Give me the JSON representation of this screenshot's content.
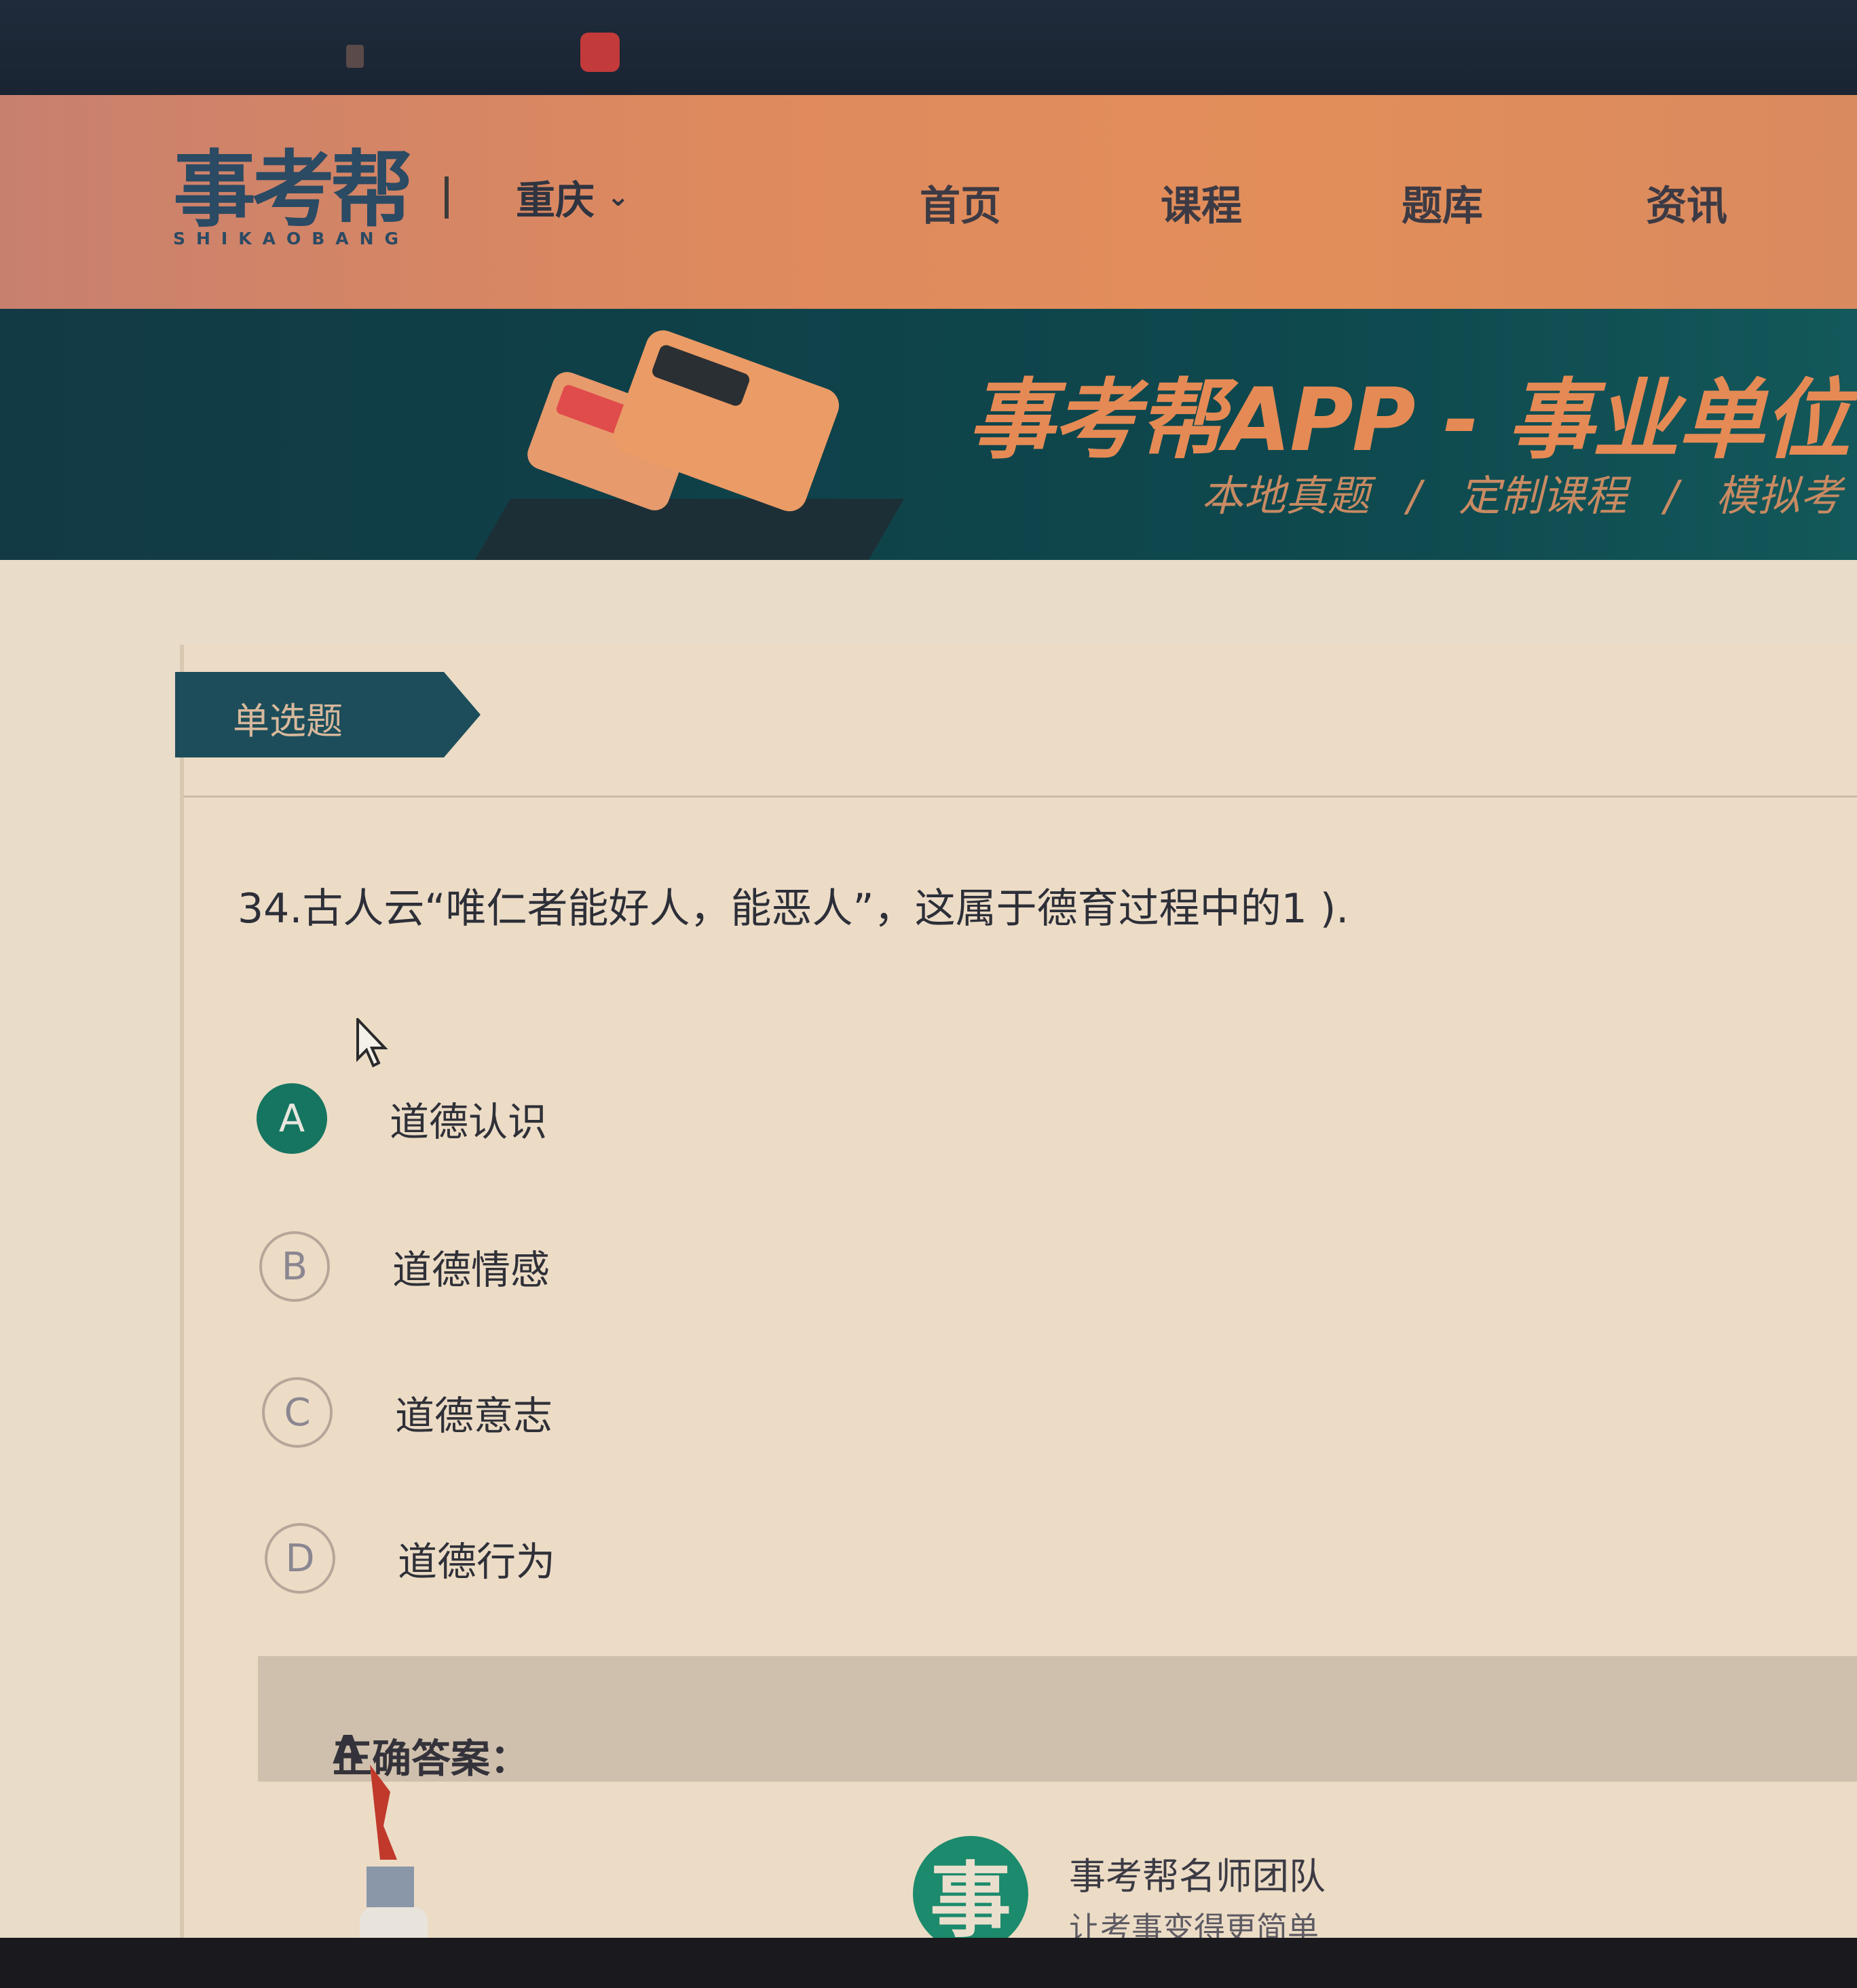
{
  "header": {
    "logo_text": "事考帮",
    "logo_subtext": "SHIKAOBANG",
    "city": "重庆",
    "nav": [
      "首页",
      "课程",
      "题库",
      "资讯"
    ]
  },
  "banner": {
    "title": "事考帮APP - 事业单位",
    "subtitle_items": [
      "本地真题",
      "定制课程",
      "模拟考"
    ],
    "separator": "/"
  },
  "question": {
    "type_label": "单选题",
    "text": "34.古人云“唯仁者能好人，能恶人”，这属于德育过程中的1 ).",
    "options": [
      {
        "letter": "A",
        "text": "道德认识",
        "selected": true
      },
      {
        "letter": "B",
        "text": "道德情感",
        "selected": false
      },
      {
        "letter": "C",
        "text": "道德意志",
        "selected": false
      },
      {
        "letter": "D",
        "text": "道德行为",
        "selected": false
      }
    ],
    "answer_label": "正确答案：",
    "answer_value": "A"
  },
  "team": {
    "logo_char": "事",
    "name": "事考帮名师团队",
    "slogan": "让考事变得更简单"
  },
  "colors": {
    "header_orange": "#e38e5a",
    "banner_teal": "#0f4048",
    "selected_green": "#157560",
    "brand_blue": "#2b4a63"
  }
}
